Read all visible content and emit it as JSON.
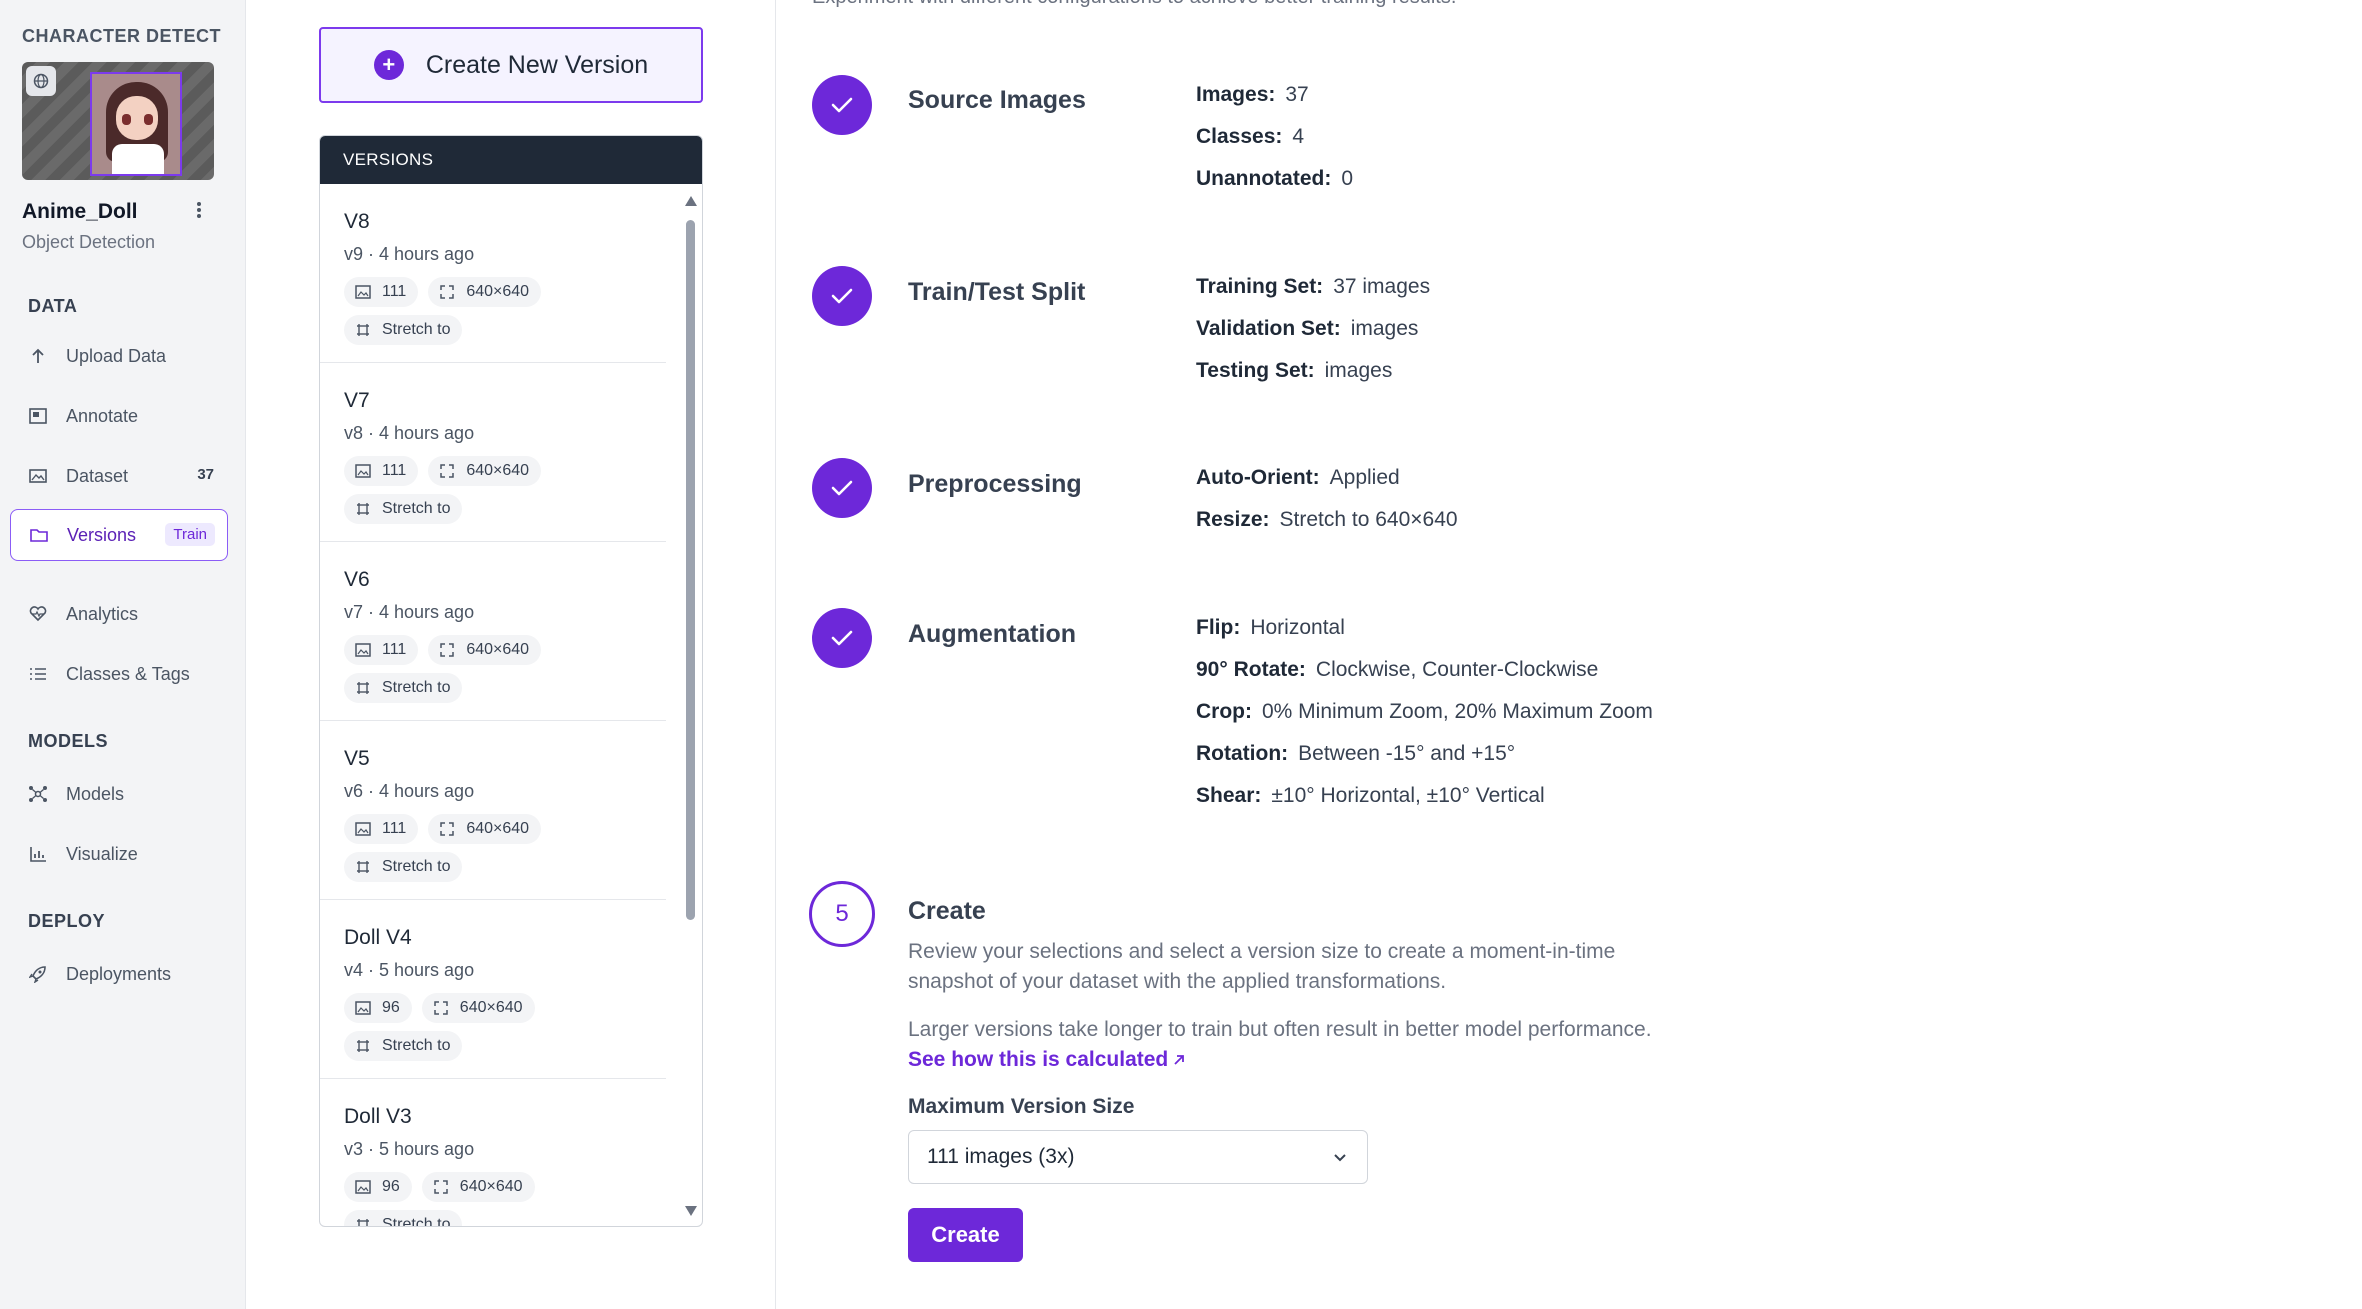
{
  "sidebar": {
    "workspace": "CHARACTER DETECT",
    "project_name": "Anime_Doll",
    "project_type": "Object Detection",
    "sections": {
      "data": "DATA",
      "models": "MODELS",
      "deploy": "DEPLOY"
    },
    "items": [
      {
        "label": "Upload Data",
        "icon": "upload-icon"
      },
      {
        "label": "Annotate",
        "icon": "annotate-icon"
      },
      {
        "label": "Dataset",
        "icon": "images-icon",
        "badge": "37"
      },
      {
        "label": "Versions",
        "icon": "folder-icon",
        "pill": "Train"
      },
      {
        "label": "Analytics",
        "icon": "heart-pulse-icon"
      },
      {
        "label": "Classes & Tags",
        "icon": "list-icon"
      },
      {
        "label": "Models",
        "icon": "network-icon"
      },
      {
        "label": "Visualize",
        "icon": "chart-icon"
      },
      {
        "label": "Deployments",
        "icon": "rocket-icon"
      }
    ]
  },
  "versions": {
    "create_label": "Create New Version",
    "header": "VERSIONS",
    "cards": [
      {
        "name": "V8",
        "sub": "v9 · 4 hours ago",
        "images": "111",
        "size": "640×640",
        "resize": "Stretch to"
      },
      {
        "name": "V7",
        "sub": "v8 · 4 hours ago",
        "images": "111",
        "size": "640×640",
        "resize": "Stretch to"
      },
      {
        "name": "V6",
        "sub": "v7 · 4 hours ago",
        "images": "111",
        "size": "640×640",
        "resize": "Stretch to"
      },
      {
        "name": "V5",
        "sub": "v6 · 4 hours ago",
        "images": "111",
        "size": "640×640",
        "resize": "Stretch to"
      },
      {
        "name": "Doll V4",
        "sub": "v4 · 5 hours ago",
        "images": "96",
        "size": "640×640",
        "resize": "Stretch to"
      },
      {
        "name": "Doll V3",
        "sub": "v3 · 5 hours ago",
        "images": "96",
        "size": "640×640",
        "resize": "Stretch to"
      }
    ]
  },
  "main": {
    "intro": "Experiment with different configurations to achieve better training results.",
    "steps": {
      "source": {
        "title": "Source Images",
        "rows": [
          {
            "label": "Images:",
            "value": "37"
          },
          {
            "label": "Classes:",
            "value": "4"
          },
          {
            "label": "Unannotated:",
            "value": "0"
          }
        ]
      },
      "split": {
        "title": "Train/Test Split",
        "rows": [
          {
            "label": "Training Set:",
            "value": "37 images"
          },
          {
            "label": "Validation Set:",
            "value": "images"
          },
          {
            "label": "Testing Set:",
            "value": "images"
          }
        ]
      },
      "preprocessing": {
        "title": "Preprocessing",
        "rows": [
          {
            "label": "Auto-Orient:",
            "value": "Applied"
          },
          {
            "label": "Resize:",
            "value": "Stretch to 640×640"
          }
        ]
      },
      "augmentation": {
        "title": "Augmentation",
        "rows": [
          {
            "label": "Flip:",
            "value": "Horizontal"
          },
          {
            "label": "90° Rotate:",
            "value": "Clockwise, Counter-Clockwise"
          },
          {
            "label": "Crop:",
            "value": "0% Minimum Zoom, 20% Maximum Zoom"
          },
          {
            "label": "Rotation:",
            "value": "Between -15° and +15°"
          },
          {
            "label": "Shear:",
            "value": "±10° Horizontal, ±10° Vertical"
          }
        ]
      },
      "create": {
        "number": "5",
        "title": "Create",
        "text1": "Review your selections and select a version size to create a moment-in-time snapshot of your dataset with the applied transformations.",
        "text2": "Larger versions take longer to train but often result in better model performance.",
        "link": "See how this is calculated",
        "field_label": "Maximum Version Size",
        "select_value": "111 images (3x)",
        "button": "Create"
      }
    }
  },
  "colors": {
    "accent": "#6d28d9",
    "header_dark": "#1f2937",
    "sidebar_bg": "#f3f4f6"
  }
}
